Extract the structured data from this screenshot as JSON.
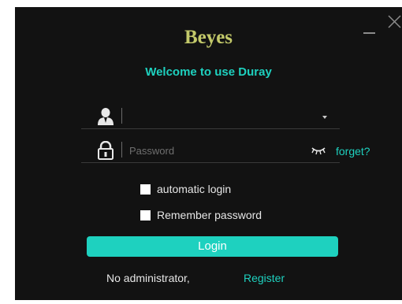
{
  "brand": {
    "logo_text": "Beyes",
    "welcome_text": "Welcome to use Duray",
    "logo_color": "#c3c96a",
    "accent_color": "#1ed1bf"
  },
  "window_controls": {
    "minimize_icon": "minimize-icon",
    "close_icon": "close-icon"
  },
  "username_field": {
    "icon": "user-icon",
    "value": "",
    "placeholder": "",
    "dropdown_icon": "caret-down-icon"
  },
  "password_field": {
    "icon": "lock-icon",
    "value": "",
    "placeholder": "Password",
    "visibility_icon": "eye-closed-icon",
    "forget_label": "forget?"
  },
  "options": {
    "automatic_login": {
      "label": "automatic login",
      "checked": false
    },
    "remember_password": {
      "label": "Remember password",
      "checked": false
    }
  },
  "login_button": {
    "label": "Login"
  },
  "footer": {
    "prompt": "No administrator,",
    "register_label": "Register"
  }
}
